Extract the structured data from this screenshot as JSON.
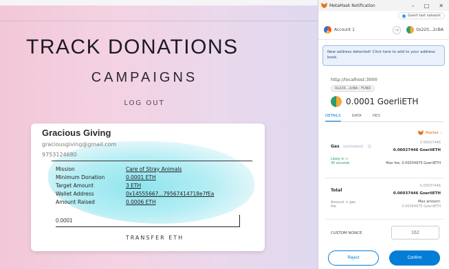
{
  "dapp": {
    "title": "TRACK DONATIONS",
    "subtitle": "CAMPAIGNS",
    "logout_label": "LOG OUT",
    "campaign": {
      "name": "Gracious Giving",
      "email": "graciousgiving@gmail.com",
      "phone": "9753124680",
      "details": [
        {
          "key": "Mission",
          "value": "Care of Stray Animals"
        },
        {
          "key": "Minimum Donation",
          "value": "0.0001 ETH"
        },
        {
          "key": "Target Amount",
          "value": "3 ETH"
        },
        {
          "key": "Wallet Address",
          "value": "0x14555667...79567414718e7fEa"
        },
        {
          "key": "Amount Raised",
          "value": "0.0006 ETH"
        }
      ],
      "amount_input_value": "0.0001",
      "transfer_label": "TRANSFER ETH"
    }
  },
  "metamask": {
    "window_title": "MetaMask Notification",
    "network": "Goerli test network",
    "from_account": "Account 1",
    "to_address": "0x220...2cBA",
    "notice": "New address detected! Click here to add to your address book.",
    "origin": "http://localhost:3000",
    "recipient_pill": "0x220...2cBA : FUND",
    "amount": "0.0001 GoerliETH",
    "tabs": [
      "DETAILS",
      "DATA",
      "HEX"
    ],
    "active_tab": "DETAILS",
    "market_label": "Market",
    "gas": {
      "label": "Gas",
      "estimated_tag": "(estimated)",
      "value_small": "0.00027446",
      "value_bold": "0.00027446 GoerliETH",
      "likely": "Likely in < 30 seconds",
      "max_fee": "Max fee: 0.00034975 GoerliETH"
    },
    "total": {
      "label": "Total",
      "value_small": "0.00037446",
      "value_bold": "0.00037446 GoerliETH",
      "sub": "Amount + gas fee",
      "max_amount_label": "Max amount:",
      "max_amount": "0.00044975 GoerliETH"
    },
    "nonce_label": "CUSTOM NONCE",
    "nonce_value": "162",
    "reject_label": "Reject",
    "confirm_label": "Confirm"
  }
}
